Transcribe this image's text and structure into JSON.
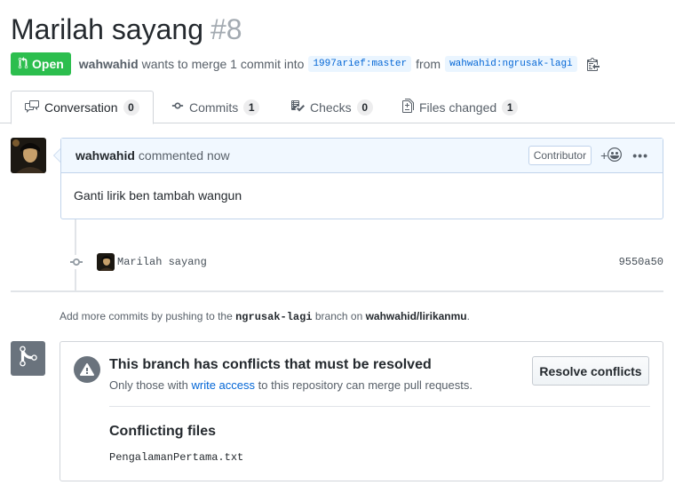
{
  "pr": {
    "title": "Marilah sayang",
    "number": "#8",
    "state": "Open",
    "author": "wahwahid",
    "merge_text": "wants to merge 1 commit into",
    "base_branch": "1997arief:master",
    "from_text": "from",
    "head_branch": "wahwahid:ngrusak-lagi"
  },
  "tabs": [
    {
      "label": "Conversation",
      "count": "0",
      "icon": "comment-discussion-icon"
    },
    {
      "label": "Commits",
      "count": "1",
      "icon": "git-commit-icon"
    },
    {
      "label": "Checks",
      "count": "0",
      "icon": "checklist-icon"
    },
    {
      "label": "Files changed",
      "count": "1",
      "icon": "file-diff-icon"
    }
  ],
  "comment": {
    "author": "wahwahid",
    "time_text": "commented now",
    "role_label": "Contributor",
    "body": "Ganti lirik ben tambah wangun"
  },
  "commit": {
    "message": "Marilah sayang",
    "sha": "9550a50"
  },
  "hint": {
    "prefix": "Add more commits by pushing to the",
    "branch": "ngrusak-lagi",
    "middle": "branch on",
    "repo": "wahwahid/lirikanmu",
    "suffix": "."
  },
  "merge": {
    "conflict_title": "This branch has conflicts that must be resolved",
    "sub_prefix": "Only those with",
    "sub_link": "write access",
    "sub_suffix": "to this repository can merge pull requests.",
    "resolve_label": "Resolve conflicts",
    "files_title": "Conflicting files",
    "files": [
      "PengalamanPertama.txt"
    ]
  },
  "colors": {
    "open_green": "#2cbe4e",
    "link_blue": "#0366d6",
    "comment_header_bg": "#f1f8ff"
  }
}
